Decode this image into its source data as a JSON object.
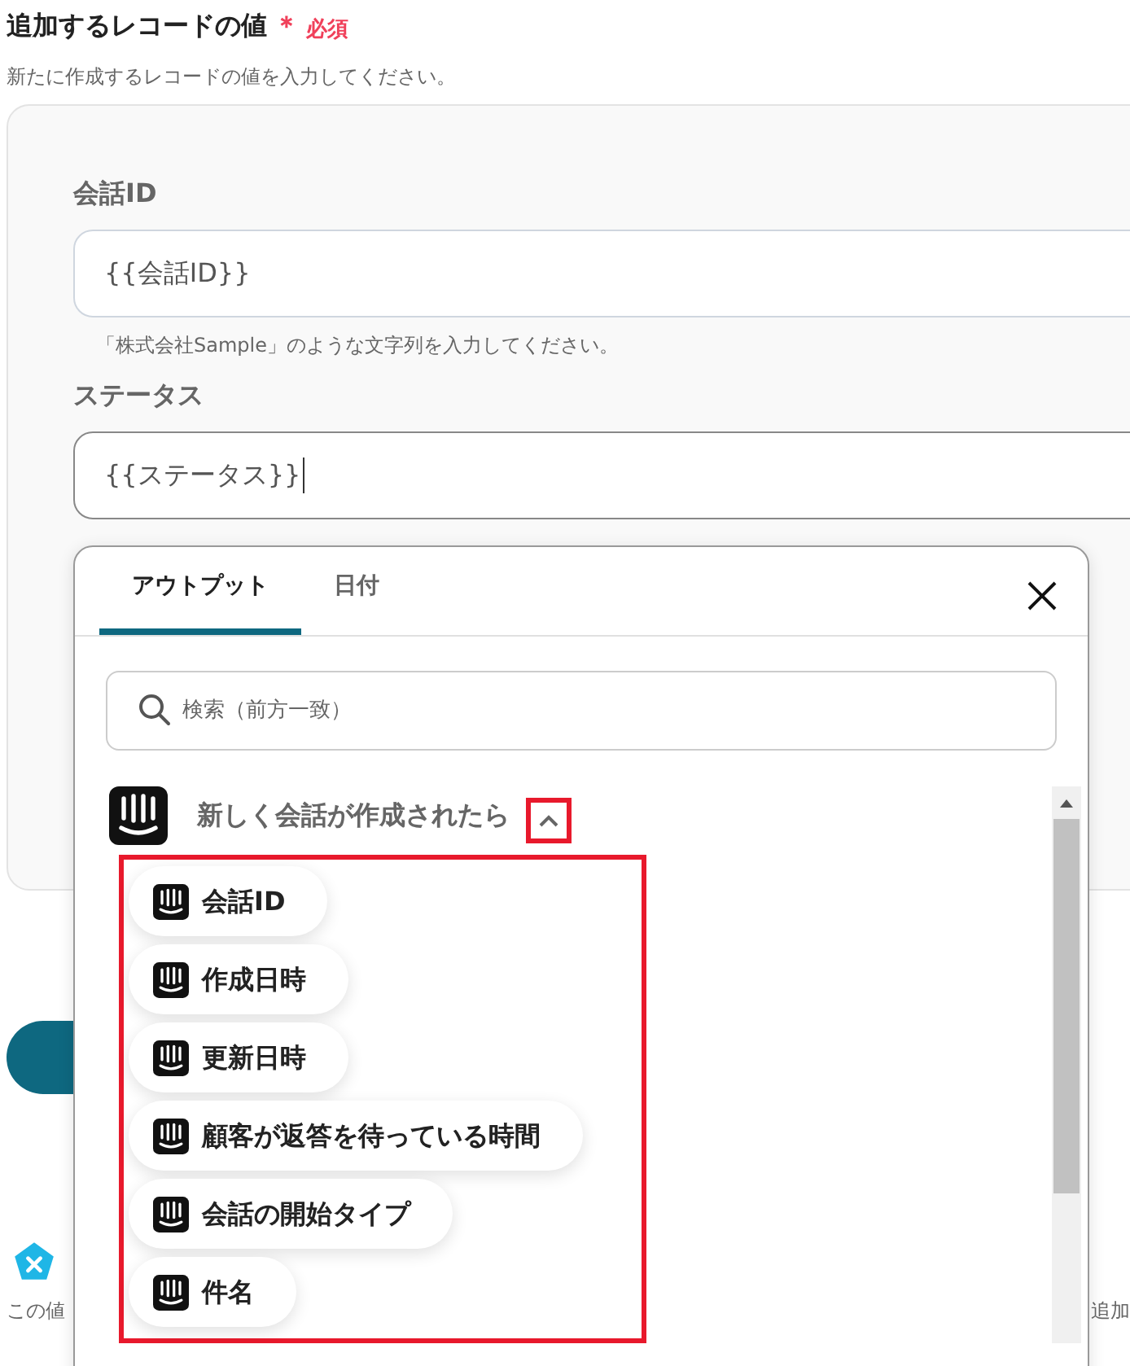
{
  "section": {
    "title": "追加するレコードの値",
    "required_mark": "＊",
    "required_label": "必須",
    "description": "新たに作成するレコードの値を入力してください。"
  },
  "fields": [
    {
      "label": "会話ID",
      "value": "{{会話ID}}",
      "hint": "「株式会社Sample」のような文字列を入力してください。",
      "focused": false
    },
    {
      "label": "ステータス",
      "value": "{{ステータス}}",
      "focused": true
    }
  ],
  "below": {
    "text_left": "この値",
    "text_right": "追加"
  },
  "popover": {
    "tabs": [
      {
        "label": "アウトプット",
        "selected": true
      },
      {
        "label": "日付",
        "selected": false
      }
    ],
    "search": {
      "placeholder": "検索（前方一致）"
    },
    "group": {
      "title": "新しく会話が作成されたら",
      "expanded": true,
      "items": [
        {
          "label": "会話ID"
        },
        {
          "label": "作成日時"
        },
        {
          "label": "更新日時"
        },
        {
          "label": "顧客が返答を待っている時間"
        },
        {
          "label": "会話の開始タイプ"
        },
        {
          "label": "件名"
        }
      ]
    }
  }
}
